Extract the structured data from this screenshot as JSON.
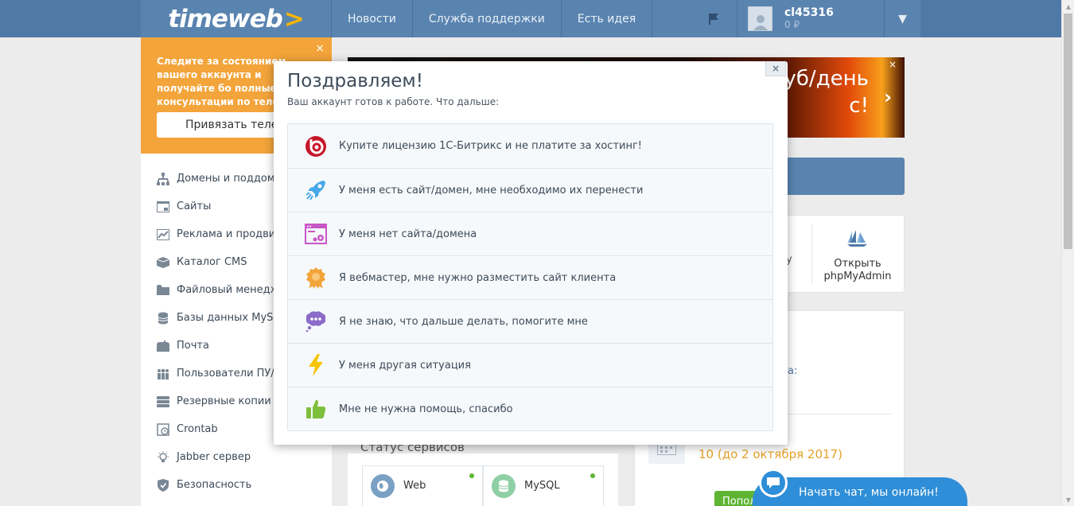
{
  "header": {
    "logo": "timeweb",
    "logo_chevron": ">",
    "nav": [
      "Новости",
      "Служба поддержки",
      "Есть идея"
    ],
    "user_name": "cl45316",
    "user_balance": "0 ₽",
    "dropdown_glyph": "▼"
  },
  "promo": {
    "text": "Следите за состоянием вашего аккаунта и получайте бо полные консультации по телефону и чату.",
    "button": "Привязать телеф",
    "close": "×"
  },
  "sidebar": {
    "items": [
      {
        "label": "Домены и поддоме",
        "icon": "sitemap-icon"
      },
      {
        "label": "Сайты",
        "icon": "browser-icon"
      },
      {
        "label": "Реклама и продвиже",
        "icon": "chart-icon"
      },
      {
        "label": "Каталог CMS",
        "icon": "box-icon"
      },
      {
        "label": "Файловый менеджер",
        "icon": "folder-icon"
      },
      {
        "label": "Базы данных MySQL",
        "icon": "database-icon"
      },
      {
        "label": "Почта",
        "icon": "mailbox-icon"
      },
      {
        "label": "Пользователи ПУ/FT",
        "icon": "users-icon"
      },
      {
        "label": "Резервные копии",
        "icon": "backup-icon"
      },
      {
        "label": "Crontab",
        "icon": "cron-icon"
      },
      {
        "label": "Jabber сервер",
        "icon": "bulb-icon"
      },
      {
        "label": "Безопасность",
        "icon": "shield-icon"
      }
    ]
  },
  "banner": {
    "line1": "уб/день",
    "line2": "с!",
    "close": "×",
    "next": "›"
  },
  "tools": {
    "cut_text": "у",
    "pma_line1": "Открыть",
    "pma_line2": "phpMyAdmin"
  },
  "account": {
    "colon": "а:",
    "period": "10 (до 2 октября 2017)",
    "pay_button": "Попол"
  },
  "status": {
    "title": "Статус сервисов",
    "services": [
      {
        "label": "Web",
        "color": "#7aa0c4"
      },
      {
        "label": "MySQL",
        "color": "#8fcfa5"
      }
    ]
  },
  "chat": {
    "label": "Начать чат, мы онлайн!"
  },
  "modal": {
    "close": "×",
    "title": "Поздравляем!",
    "subtitle": "Ваш аккаунт готов к работе. Что дальше:",
    "options": [
      {
        "label": "Купите лицензию 1С-Битрикс и не платите за хостинг!",
        "icon": "bitrix-icon"
      },
      {
        "label": "У меня есть сайт/домен, мне необходимо их перенести",
        "icon": "rocket-icon"
      },
      {
        "label": "У меня нет сайта/домена",
        "icon": "site-settings-icon"
      },
      {
        "label": "Я вебмастер, мне нужно разместить сайт клиента",
        "icon": "award-icon"
      },
      {
        "label": "Я не знаю, что дальше делать, помогите мне",
        "icon": "thought-bubble-icon"
      },
      {
        "label": "У меня другая ситуация",
        "icon": "lightning-icon"
      },
      {
        "label": "Мне не нужна помощь, спасибо",
        "icon": "thumbs-up-icon"
      }
    ]
  }
}
